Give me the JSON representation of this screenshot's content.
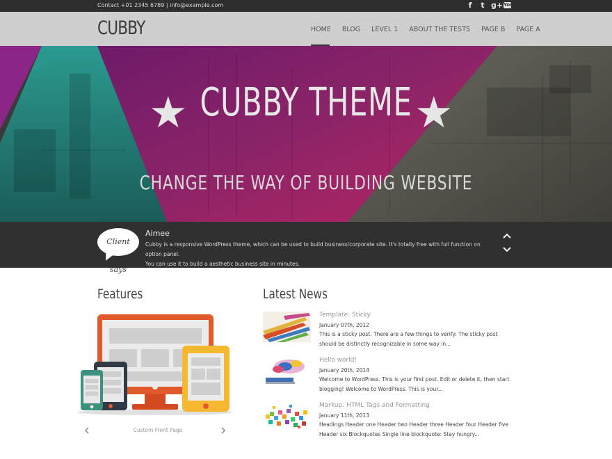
{
  "topbar": {
    "contact": "Contact +01 2345 6789 | info@example.com",
    "social": [
      {
        "icon": "facebook-icon",
        "glyph": "f"
      },
      {
        "icon": "twitter-icon",
        "glyph": "t"
      },
      {
        "icon": "google-plus-icon",
        "glyph": "g+"
      },
      {
        "icon": "youtube-icon",
        "glyph": "You"
      }
    ]
  },
  "header": {
    "logo": "CUBBY",
    "nav": [
      "HOME",
      "BLOG",
      "LEVEL 1",
      "ABOUT THE TESTS",
      "PAGE B",
      "PAGE A"
    ],
    "active_nav": "HOME"
  },
  "hero": {
    "title": "CUBBY THEME",
    "subtitle": "CHANGE THE WAY OF BUILDING WEBSITE",
    "colors": {
      "magenta": "#9a1f7c",
      "teal": "#1f8f8a",
      "pink": "#c02a6c",
      "gray": "#5a5a52"
    }
  },
  "testimonial": {
    "bubble": "Client says",
    "name": "Aimee",
    "line1": "Cubby is a responsive WordPress theme, which can be used to build business/corporate site. It's totally free with full function on option panel.",
    "line2": "You can use it to build a aesthetic business site in minutes."
  },
  "features": {
    "title": "Features",
    "caption": "Custom Front Page"
  },
  "news": {
    "title": "Latest News",
    "items": [
      {
        "title": "Template: Sticky",
        "date": "January 07th, 2012",
        "text": "This is a sticky post. There are a few things to verify: The sticky post should be distinctly recognizable in some way in..."
      },
      {
        "title": "Hello world!",
        "date": "January 20th, 2014",
        "text": "Welcome to WordPress. This is your first post. Edit or delete it, then start blogging! Welcome to WordPress. This is your..."
      },
      {
        "title": "Markup: HTML Tags and Formatting",
        "date": "January 11th, 2013",
        "text": "Headings Header one Header two Header three Header four Header five Header six Blockquotes Single line blockquote: Stay hungry..."
      }
    ]
  }
}
